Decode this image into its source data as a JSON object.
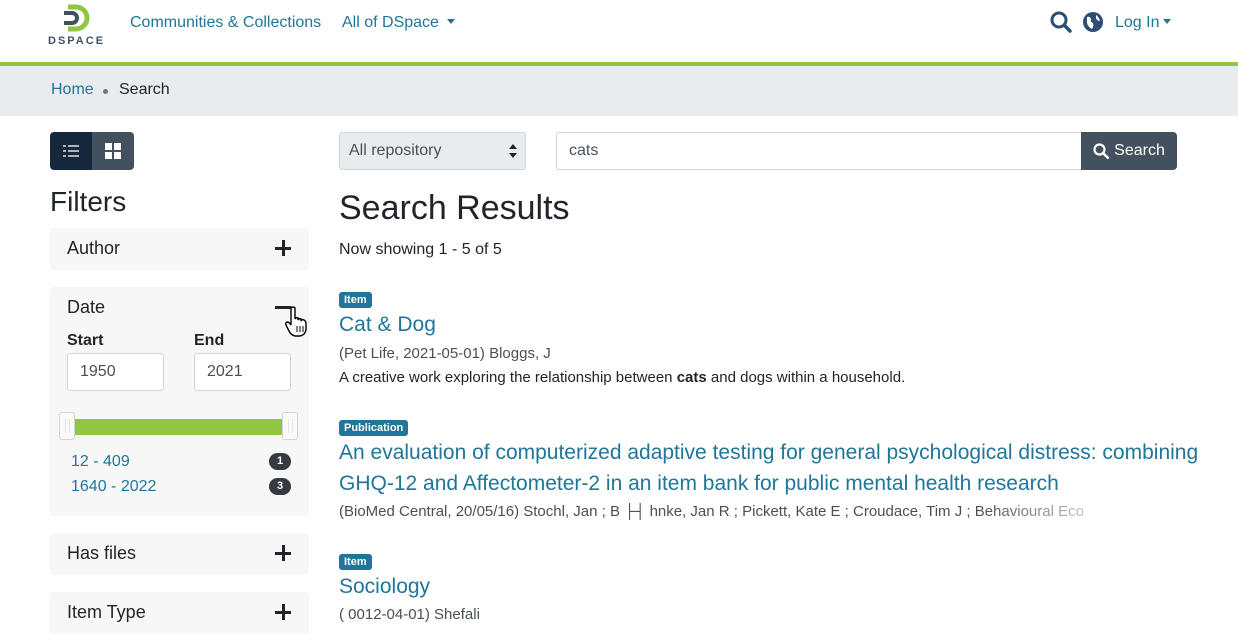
{
  "header": {
    "logo_text": "DSPACE",
    "nav": {
      "communities": "Communities & Collections",
      "all_of_dspace": "All of DSpace"
    },
    "login": "Log In"
  },
  "breadcrumb": {
    "home": "Home",
    "current": "Search"
  },
  "sidebar": {
    "filters_title": "Filters",
    "facets": {
      "author": "Author",
      "date": {
        "title": "Date",
        "start_label": "Start",
        "end_label": "End",
        "start_value": "1950",
        "end_value": "2021",
        "ranges": [
          {
            "label": "12 - 409",
            "count": "1"
          },
          {
            "label": "1640 - 2022",
            "count": "3"
          }
        ]
      },
      "has_files": "Has files",
      "item_type": "Item Type"
    }
  },
  "search": {
    "scope": "All repository",
    "query": "cats",
    "button": "Search"
  },
  "results": {
    "title": "Search Results",
    "count": "Now showing 1 - 5 of 5",
    "items": [
      {
        "type": "Item",
        "title": "Cat & Dog",
        "meta": "(Pet Life, 2021-05-01) Bloggs, J",
        "abstract_before": "A creative work exploring the relationship between ",
        "abstract_highlight": "cats",
        "abstract_after": " and dogs within a household."
      },
      {
        "type": "Publication",
        "title_line1": "An evaluation of computerized adaptive testing for general psychological distress: combining",
        "title_line2": "GHQ-12 and Affectometer-2 in an item bank for public mental health research",
        "meta": "(BioMed Central, 20/05/16) Stochl, Jan ; B ├┤ hnke, Jan R ; Pickett, Kate E ; Croudace, Tim J ; Behavioural Eco"
      },
      {
        "type": "Item",
        "title": "Sociology",
        "meta": "( 0012-04-01) Shefali"
      }
    ]
  },
  "colors": {
    "accent_green": "#92c642",
    "link_blue": "#207698",
    "dark_button": "#43515f"
  }
}
